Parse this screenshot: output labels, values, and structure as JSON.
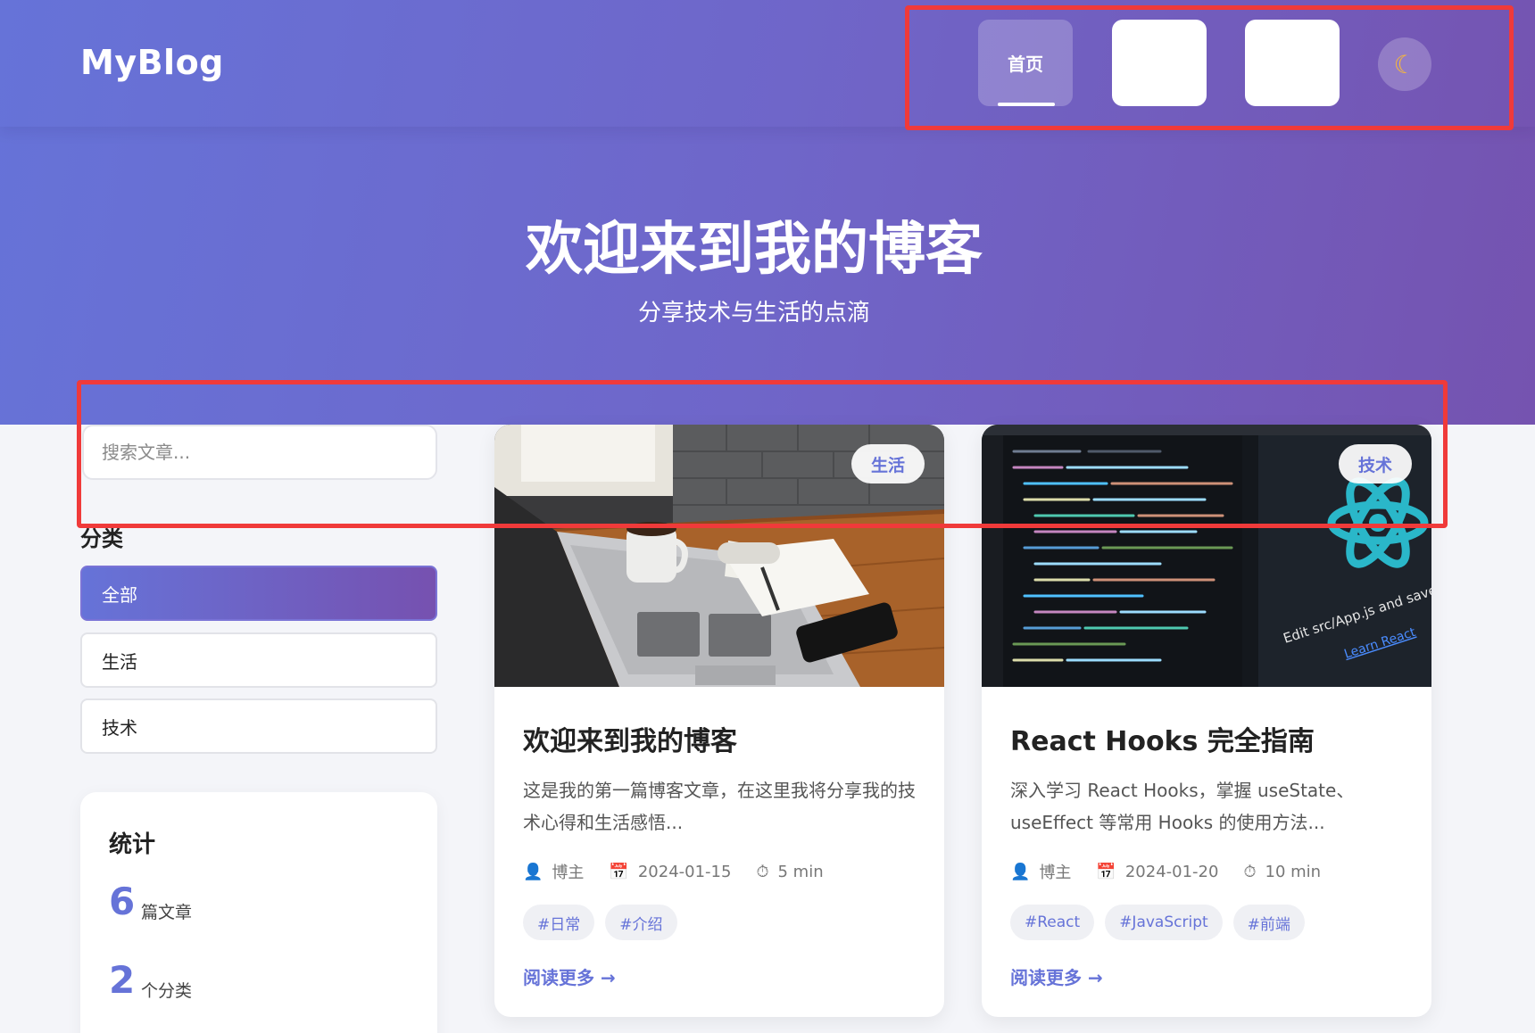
{
  "nav": {
    "brand": "MyBlog",
    "home_label": "首页",
    "theme_icon": "moon-icon"
  },
  "hero": {
    "title": "欢迎来到我的博客",
    "subtitle": "分享技术与生活的点滴"
  },
  "sidebar": {
    "search_placeholder": "搜索文章...",
    "categories_title": "分类",
    "categories": [
      "全部",
      "生活",
      "技术"
    ],
    "active_category": "全部",
    "stats_title": "统计",
    "stats": [
      {
        "value": "6",
        "label": "篇文章"
      },
      {
        "value": "2",
        "label": "个分类"
      }
    ]
  },
  "posts": [
    {
      "badge": "生活",
      "title": "欢迎来到我的博客",
      "excerpt": "这是我的第一篇博客文章，在这里我将分享我的技术心得和生活感悟...",
      "author": "博主",
      "date": "2024-01-15",
      "read_time": "5 min",
      "tags": [
        "#日常",
        "#介绍"
      ],
      "read_more": "阅读更多 →"
    },
    {
      "badge": "技术",
      "title": "React Hooks 完全指南",
      "excerpt": "深入学习 React Hooks，掌握 useState、useEffect 等常用 Hooks 的使用方法...",
      "author": "博主",
      "date": "2024-01-20",
      "read_time": "10 min",
      "tags": [
        "#React",
        "#JavaScript",
        "#前端"
      ],
      "read_more": "阅读更多 →",
      "image_text": [
        "Edit src/App.js and save to reload.",
        "Learn React"
      ]
    }
  ],
  "colors": {
    "accent": "#6673d8",
    "gradient_start": "#6673d8",
    "gradient_end": "#7553b0",
    "highlight_red": "#f03a3a"
  }
}
